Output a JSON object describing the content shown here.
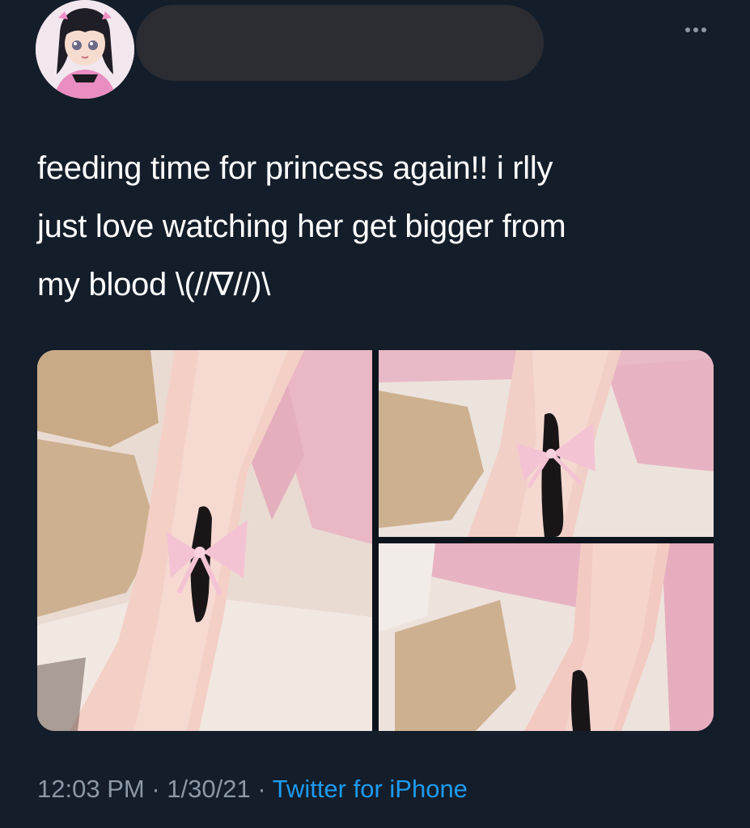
{
  "tweet": {
    "text": "feeding time for princess again!! i rlly\njust love watching her get bigger from\nmy blood \\(//∇//)\\",
    "time": "12:03 PM",
    "separator": " · ",
    "date": "1/30/21",
    "source": "Twitter for iPhone"
  },
  "colors": {
    "background": "#141d2a",
    "text": "#ffffff",
    "meta": "#8b98a5",
    "link": "#1d9bf0"
  },
  "icons": {
    "more": "more-horizontal-icon"
  }
}
